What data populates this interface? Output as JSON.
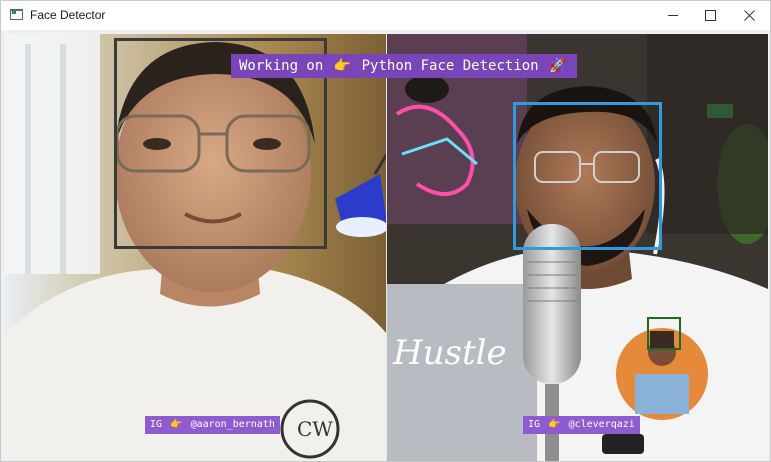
{
  "window": {
    "title": "Face Detector",
    "controls": {
      "minimize": "—",
      "maximize": "☐",
      "close": "✕"
    }
  },
  "video": {
    "banner": {
      "prefix": "Working on",
      "pointer": "👉",
      "text": "Python Face Detection",
      "rocket": "🚀"
    },
    "left_tag": {
      "prefix": "IG",
      "pointer": "👉",
      "handle": "@aaron_bernath"
    },
    "right_tag": {
      "prefix": "IG",
      "pointer": "👉",
      "handle": "@cleverqazi"
    },
    "shirt_logo_text": "Hustle",
    "box_colors": {
      "left_face": "#3a3a3a",
      "right_face": "#2f9ae0",
      "shirt_face": "#1f6b1f"
    }
  }
}
